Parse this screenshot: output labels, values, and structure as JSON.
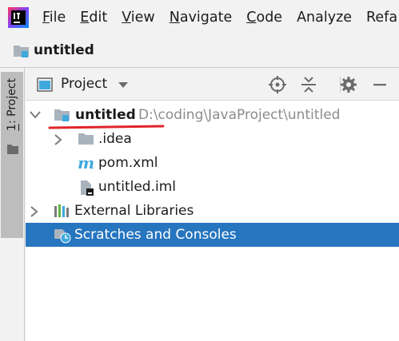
{
  "menubar": {
    "items": [
      {
        "mnemonic": "F",
        "rest": "ile"
      },
      {
        "mnemonic": "E",
        "rest": "dit"
      },
      {
        "mnemonic": "V",
        "rest": "iew"
      },
      {
        "mnemonic": "N",
        "rest": "avigate"
      },
      {
        "mnemonic": "C",
        "rest": "ode"
      },
      {
        "mnemonic": "",
        "rest": "Analyze"
      },
      {
        "mnemonic": "",
        "rest": "Refa"
      }
    ]
  },
  "navbar": {
    "project_name": "untitled"
  },
  "stripe": {
    "tab_number": "1",
    "tab_rest": ": Project"
  },
  "panel": {
    "view_title": "Project"
  },
  "tree": {
    "root": {
      "label": "untitled",
      "path": "D:\\coding\\JavaProject\\untitled"
    },
    "idea": {
      "label": ".idea"
    },
    "pom": {
      "label": "pom.xml"
    },
    "iml": {
      "label": "untitled.iml"
    },
    "libraries": {
      "label": "External Libraries"
    },
    "scratches": {
      "label": "Scratches and Consoles"
    }
  },
  "colors": {
    "selection": "#2675bf",
    "annotation": "#e0242a",
    "folder": "#a9b3bd",
    "module_badge": "#3fa9dd"
  }
}
